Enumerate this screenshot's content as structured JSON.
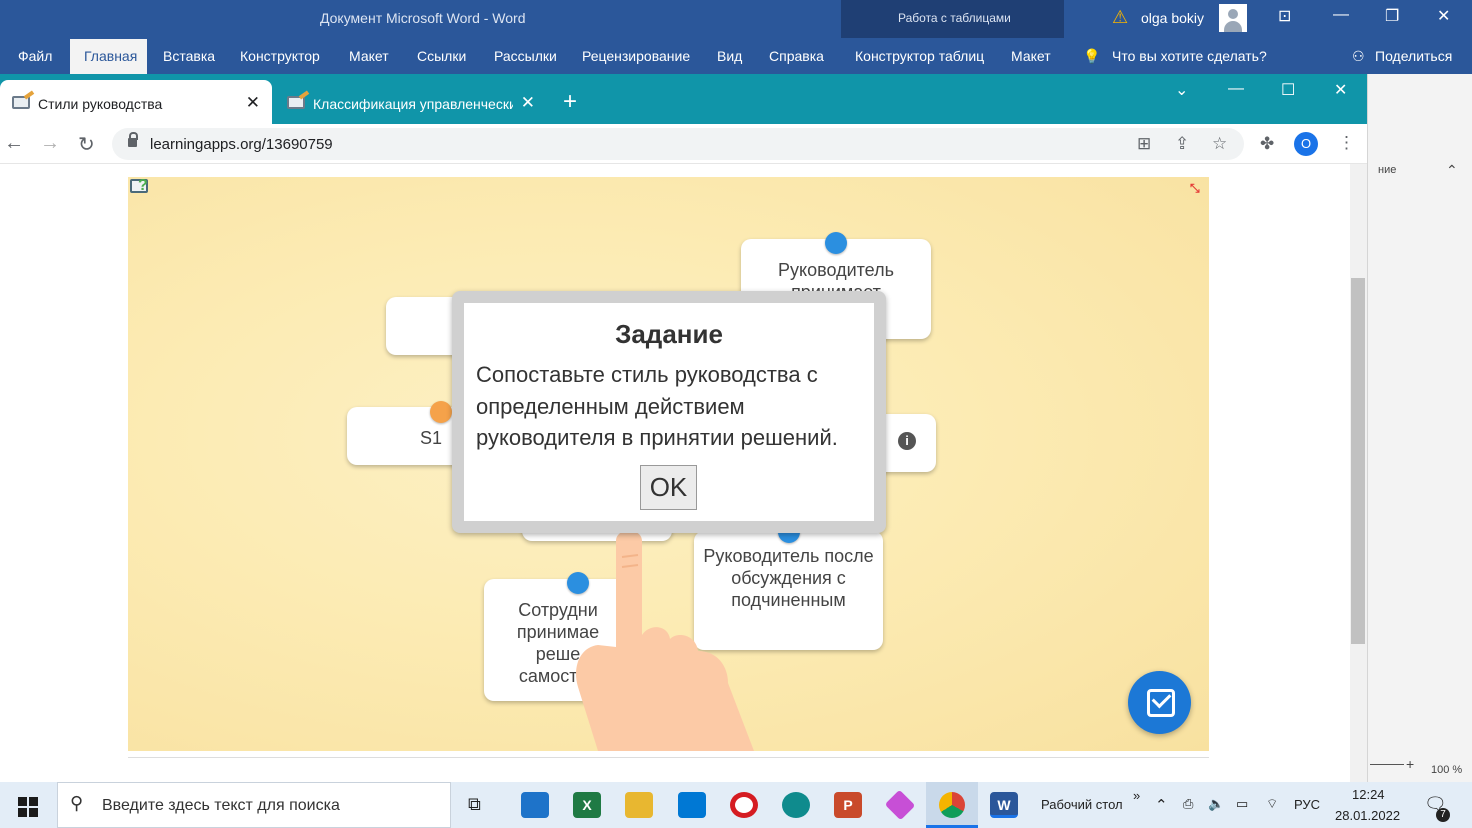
{
  "word": {
    "title": "Документ Microsoft Word  -  Word",
    "context_tab": "Работа с таблицами",
    "user": "olga bokiy",
    "tabs": [
      "Файл",
      "Главная",
      "Вставка",
      "Конструктор",
      "Макет",
      "Ссылки",
      "Рассылки",
      "Рецензирование",
      "Вид",
      "Справка",
      "Конструктор таблиц",
      "Макет"
    ],
    "tell_me": "Что вы хотите сделать?",
    "share": "Поделиться",
    "side_text": "ние",
    "zoom": "100 %"
  },
  "browser": {
    "tabs": [
      {
        "label": "Стили руководства",
        "active": true
      },
      {
        "label": "Классификация управленческих",
        "active": false
      }
    ],
    "url": "learningapps.org/13690759",
    "profile_initial": "O"
  },
  "app": {
    "cards": [
      {
        "text": "Руководитель принимает"
      },
      {
        "text": "S1"
      },
      {
        "text": "Руководитель после обсуждения с подчиненным"
      },
      {
        "text": "Сотрудни принимае реше самостоя"
      }
    ],
    "modal": {
      "title": "Задание",
      "body": "Сопоставьте стиль руководства с определенным действием руководителя в принятии решений.",
      "ok": "OK"
    }
  },
  "taskbar": {
    "search_placeholder": "Введите здесь текст для поиска",
    "desktop_label": "Рабочий стол",
    "lang": "РУС",
    "time": "12:24",
    "date": "28.01.2022",
    "notif_count": "7"
  }
}
